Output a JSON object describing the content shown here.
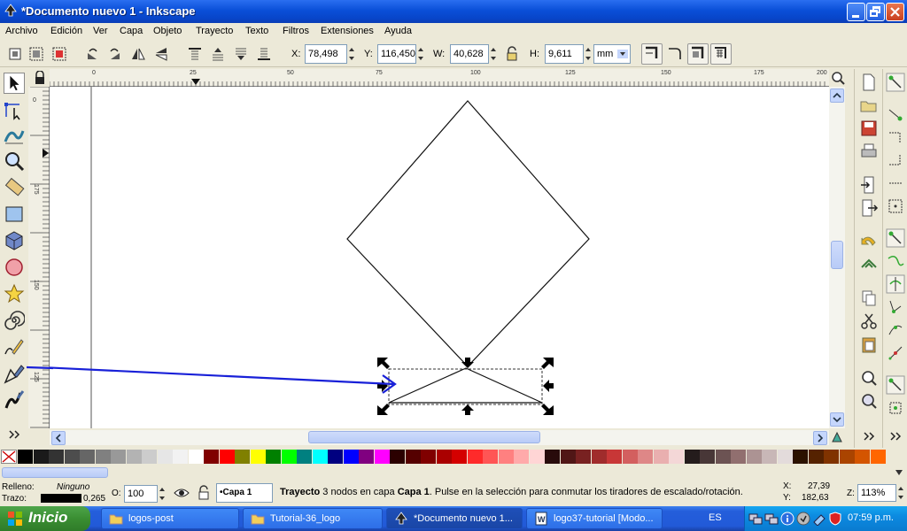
{
  "window": {
    "title": "*Documento nuevo 1 - Inkscape"
  },
  "menu": [
    "Archivo",
    "Edición",
    "Ver",
    "Capa",
    "Objeto",
    "Trayecto",
    "Texto",
    "Filtros",
    "Extensiones",
    "Ayuda"
  ],
  "toolbar": {
    "x_label": "X:",
    "x_value": "78,498",
    "y_label": "Y:",
    "y_value": "116,450",
    "w_label": "W:",
    "w_value": "40,628",
    "h_label": "H:",
    "h_value": "9,611",
    "unit": "mm"
  },
  "ruler": {
    "top_numbers": [
      "0",
      "25",
      "50",
      "75",
      "100",
      "125",
      "150",
      "175",
      "200"
    ],
    "left_numbers": [
      "0",
      "175",
      "150",
      "125"
    ]
  },
  "palette": {
    "none_mark": "×",
    "colors": [
      "#000000",
      "#1a1a1a",
      "#333333",
      "#4d4d4d",
      "#666666",
      "#808080",
      "#999999",
      "#b3b3b3",
      "#cccccc",
      "#e6e6e6",
      "#f2f2f2",
      "#ffffff",
      "#800000",
      "#ff0000",
      "#808000",
      "#ffff00",
      "#008000",
      "#00ff00",
      "#008080",
      "#00ffff",
      "#000080",
      "#0000ff",
      "#800080",
      "#ff00ff",
      "#2b0000",
      "#550000",
      "#800000",
      "#aa0000",
      "#d40000",
      "#ff2a2a",
      "#ff5555",
      "#ff8080",
      "#ffaaaa",
      "#ffd5d5",
      "#280b0b",
      "#501616",
      "#782121",
      "#a02c2c",
      "#c83737",
      "#d35f5f",
      "#de8787",
      "#e9afaf",
      "#f4d7d7",
      "#241c1c",
      "#483737",
      "#6c5353",
      "#916f6f",
      "#ac9393",
      "#c8b7b7",
      "#e3dbdb",
      "#2b1100",
      "#552200",
      "#803300",
      "#aa4400",
      "#d45500",
      "#ff6600"
    ]
  },
  "status": {
    "fill_label": "Relleno:",
    "fill_value": "Ninguno",
    "stroke_label": "Trazo:",
    "stroke_value": "0,265",
    "opacity_label": "O:",
    "opacity_value": "100",
    "layer": "•Capa 1",
    "message_bold": "Trayecto",
    "message_mid": " 3 nodos en capa ",
    "message_layer": "Capa 1",
    "message_rest": ". Pulse en la selección para conmutar los tiradores de escalado/rotación.",
    "x_label": "X:",
    "x_value": "27,39",
    "y_label": "Y:",
    "y_value": "182,63",
    "zoom_label": "Z:",
    "zoom_value": "113%"
  },
  "taskbar": {
    "start": "Inicio",
    "tasks": [
      "logos-post",
      "Tutorial-36_logo",
      "*Documento nuevo 1...",
      "logo37-tutorial [Modo..."
    ],
    "lang": "ES",
    "clock": "07:59 p.m."
  }
}
